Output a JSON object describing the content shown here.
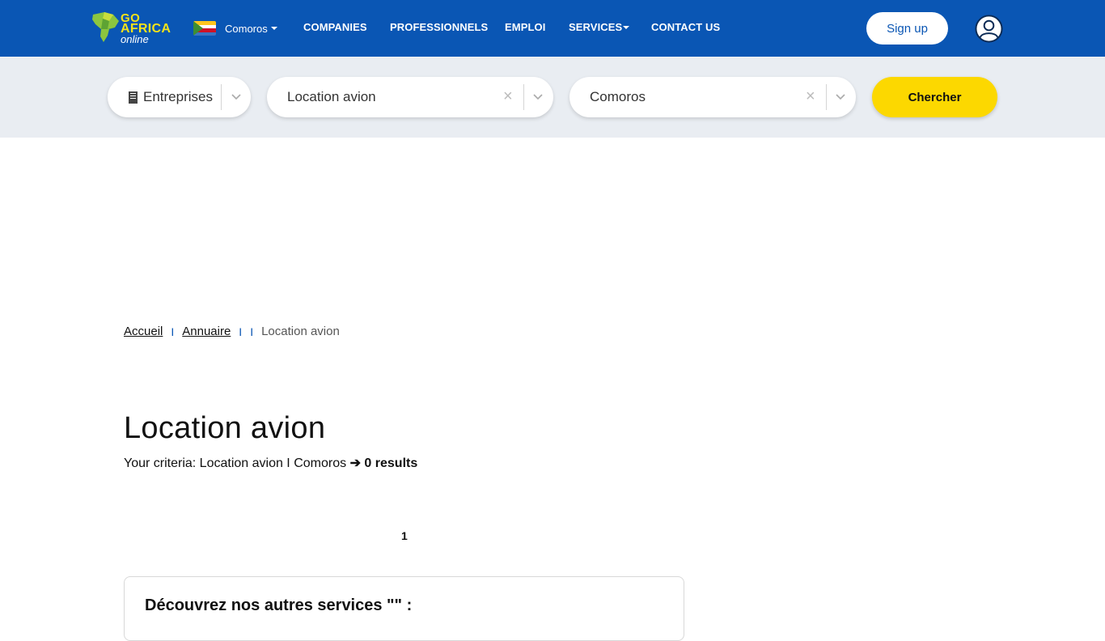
{
  "header": {
    "logo": {
      "line1": "GO",
      "line2": "AFRICA",
      "line3": "online"
    },
    "country": "Comoros",
    "nav": {
      "companies": "COMPANIES",
      "professionnels": "PROFESSIONNELS",
      "emploi": "EMPLOI",
      "services": "SERVICES",
      "contact": "CONTACT US"
    },
    "signup_label": "Sign up"
  },
  "search": {
    "type_value": "Entreprises",
    "query_value": "Location avion",
    "location_value": "Comoros",
    "clear_glyph": "×",
    "button_label": "Chercher"
  },
  "breadcrumb": {
    "home": "Accueil",
    "directory": "Annuaire",
    "current": "Location avion",
    "separator": "I"
  },
  "main": {
    "title": "Location avion",
    "criteria_prefix": "Your criteria: Location avion I Comoros",
    "criteria_arrow": "➔",
    "criteria_result": "0 results",
    "page_number": "1",
    "services_heading": "Découvrez nos autres services \"\" :"
  },
  "colors": {
    "header_bg": "#0a56b4",
    "search_bg": "#e9edf2",
    "button_yellow": "#fcd800",
    "logo_yellow": "#f3e21a"
  },
  "icons": {
    "user": "user-circle-icon",
    "building": "building-icon",
    "chevron": "chevron-down-icon",
    "clear": "clear-icon"
  }
}
